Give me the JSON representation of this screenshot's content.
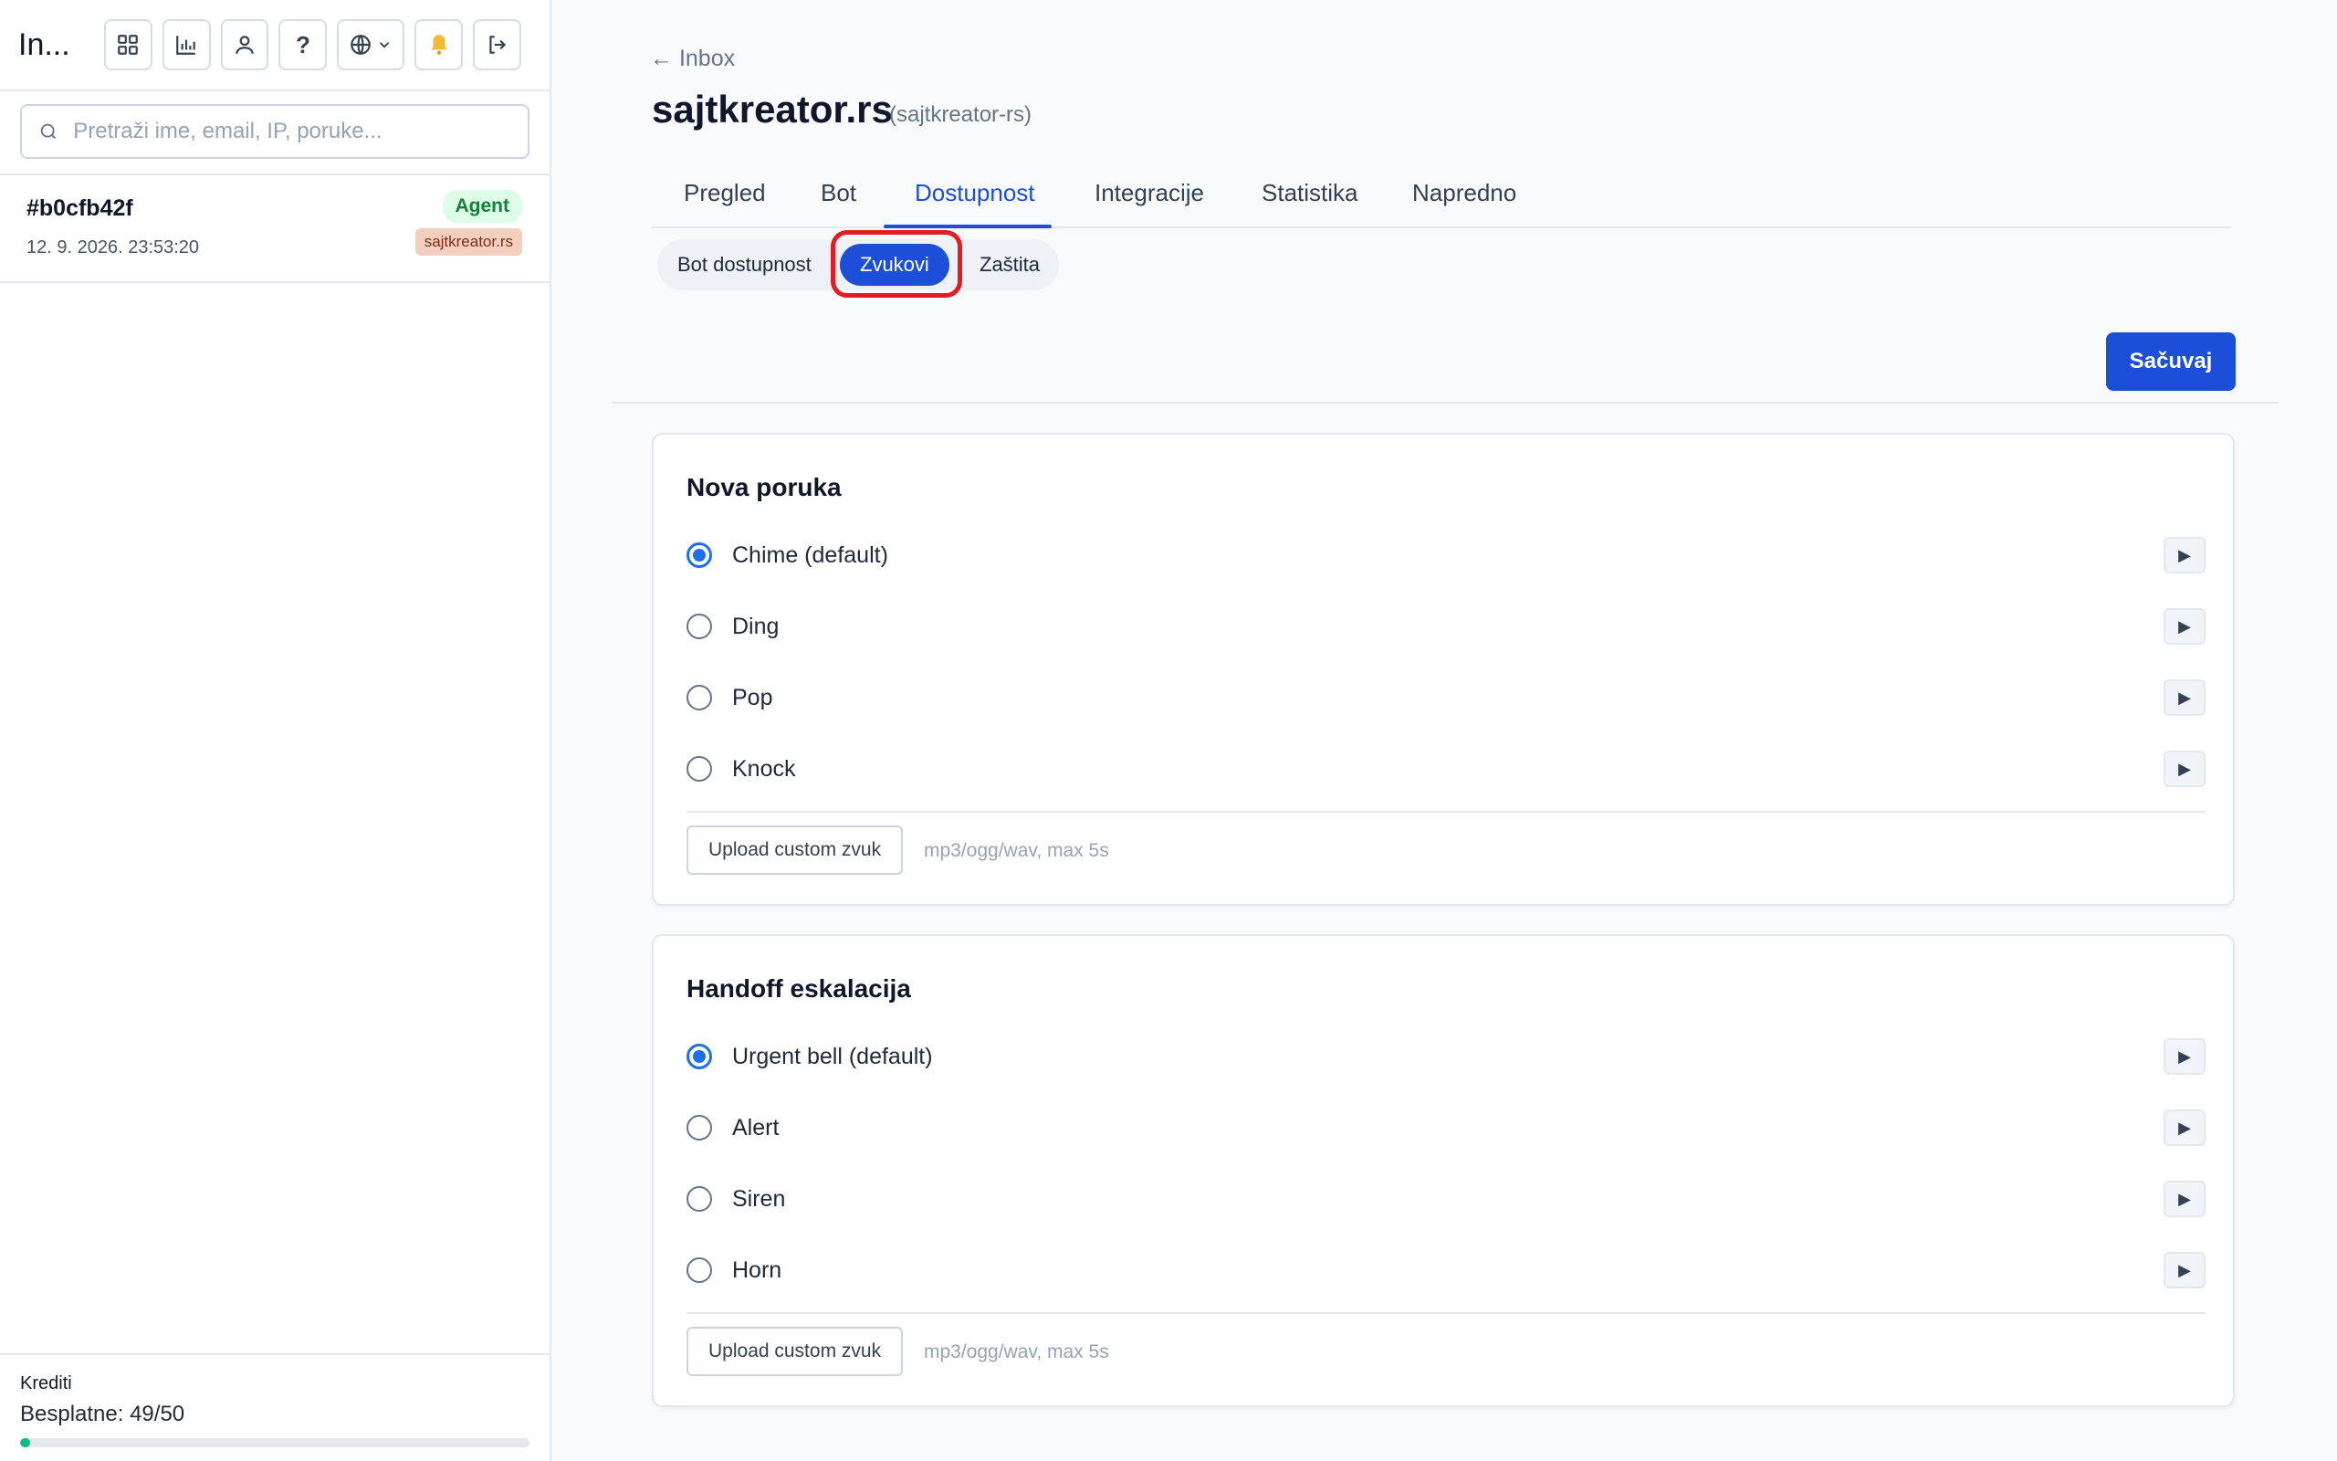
{
  "sidebar": {
    "title": "In...",
    "search_placeholder": "Pretraži ime, email, IP, poruke...",
    "header_icons": [
      "grid-icon",
      "chart-icon",
      "user-icon",
      "help-icon",
      "globe-icon",
      "bell-icon",
      "logout-icon"
    ],
    "help_glyph": "?",
    "conversation": {
      "id": "#b0cfb42f",
      "time": "12. 9. 2026. 23:53:20",
      "status": "Agent",
      "site": "sajtkreator.rs"
    },
    "credits": {
      "label": "Krediti",
      "value": "Besplatne: 49/50",
      "used": 1,
      "total": 50
    }
  },
  "main": {
    "back": "← Inbox",
    "title": "sajtkreator.rs",
    "slug": "(sajtkreator-rs)",
    "tabs": [
      "Pregled",
      "Bot",
      "Dostupnost",
      "Integracije",
      "Statistika",
      "Napredno"
    ],
    "active_tab": "Dostupnost",
    "subtabs": [
      "Bot dostupnost",
      "Zvukovi",
      "Zaštita"
    ],
    "active_subtab": "Zvukovi",
    "save_label": "Sačuvaj",
    "sections": [
      {
        "title": "Nova poruka",
        "options": [
          "Chime (default)",
          "Ding",
          "Pop",
          "Knock"
        ],
        "selected": "Chime (default)",
        "upload_label": "Upload custom zvuk",
        "hint": "mp3/ogg/wav, max 5s"
      },
      {
        "title": "Handoff eskalacija",
        "options": [
          "Urgent bell (default)",
          "Alert",
          "Siren",
          "Horn"
        ],
        "selected": "Urgent bell (default)",
        "upload_label": "Upload custom zvuk",
        "hint": "mp3/ogg/wav, max 5s"
      }
    ],
    "play_glyph": "▶"
  },
  "colors": {
    "accent": "#1d4ed8",
    "highlight": "#e11d23",
    "success": "#10b981"
  }
}
